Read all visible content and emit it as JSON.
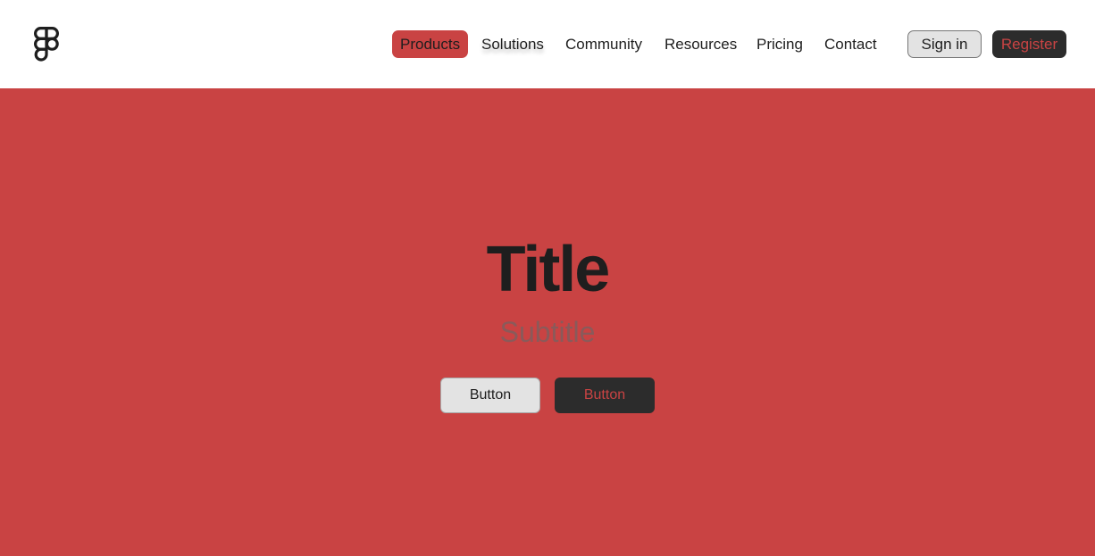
{
  "nav": {
    "logo_icon": "figma-logo-icon",
    "items": [
      {
        "label": "Products",
        "active": true
      },
      {
        "label": "Solutions",
        "active": false
      },
      {
        "label": "Community",
        "active": false
      },
      {
        "label": "Resources",
        "active": false
      },
      {
        "label": "Pricing",
        "active": false
      },
      {
        "label": "Contact",
        "active": false
      }
    ],
    "sign_in_label": "Sign in",
    "register_label": "Register"
  },
  "hero": {
    "title": "Title",
    "subtitle": "Subtitle",
    "primary_button_label": "Button",
    "secondary_button_label": "Button"
  },
  "colors": {
    "accent": "#c94343",
    "dark": "#2c2c2c",
    "light_button": "#e3e3e3",
    "text": "#1e1e1e",
    "subtitle": "#8a5a5a"
  }
}
